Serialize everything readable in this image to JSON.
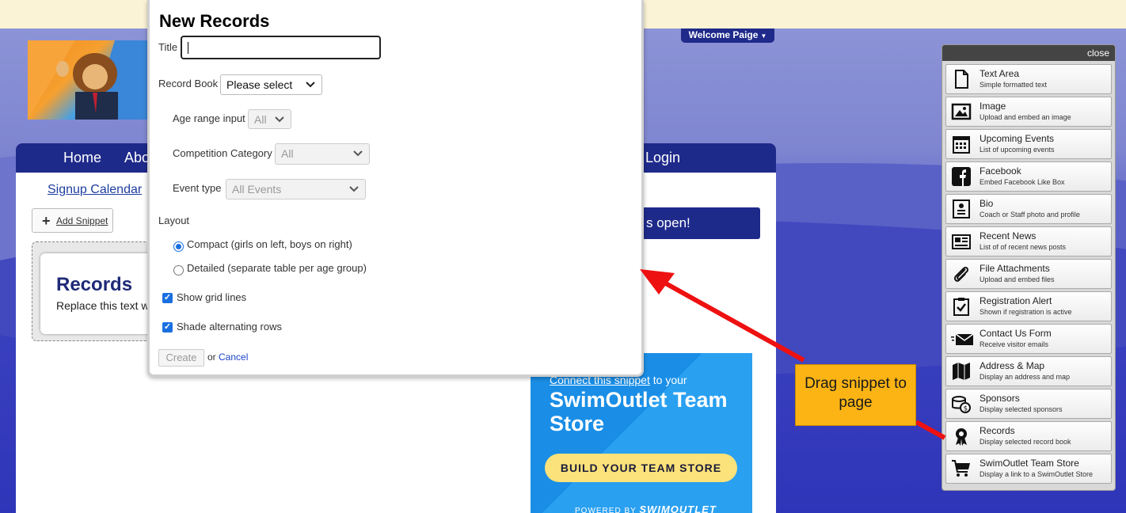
{
  "welcome": {
    "label": "Welcome Paige"
  },
  "nav": {
    "home": "Home",
    "about": "Abo",
    "login": "Login"
  },
  "page": {
    "signup_calendar": "Signup Calendar",
    "add_snippet": "Add Snippet",
    "snippet_title": "Records",
    "snippet_text": "Replace this text w",
    "registration_banner": "s open!"
  },
  "promo": {
    "connect_link": "Connect this snippet",
    "connect_rest": " to your",
    "title": "SwimOutlet Team Store",
    "button": "BUILD YOUR TEAM STORE",
    "powered_by": "POWERED BY",
    "brand": "SWIMOUTLET"
  },
  "modal": {
    "title": "New Records",
    "title_label": "Title",
    "title_value": "",
    "record_book_label": "Record Book",
    "record_book_value": "Please select",
    "age_range_label": "Age range input",
    "age_range_value": "All",
    "competition_label": "Competition Category",
    "competition_value": "All",
    "event_type_label": "Event type",
    "event_type_value": "All Events",
    "layout_label": "Layout",
    "layout_options": [
      {
        "label": "Compact (girls on left, boys on right)",
        "selected": true
      },
      {
        "label": "Detailed (separate table per age group)",
        "selected": false
      }
    ],
    "show_grid_lines": "Show grid lines",
    "shade_rows": "Shade alternating rows",
    "create": "Create",
    "or": "or",
    "cancel": "Cancel"
  },
  "panel": {
    "close": "close",
    "items": [
      {
        "name": "Text Area",
        "desc": "Simple formatted text",
        "icon": "document-icon"
      },
      {
        "name": "Image",
        "desc": "Upload and embed an image",
        "icon": "image-icon"
      },
      {
        "name": "Upcoming Events",
        "desc": "List of upcoming events",
        "icon": "calendar-icon"
      },
      {
        "name": "Facebook",
        "desc": "Embed Facebook Like Box",
        "icon": "facebook-icon"
      },
      {
        "name": "Bio",
        "desc": "Coach or Staff photo and profile",
        "icon": "profile-card-icon"
      },
      {
        "name": "Recent News",
        "desc": "List of of recent news posts",
        "icon": "newspaper-icon"
      },
      {
        "name": "File Attachments",
        "desc": "Upload and embed files",
        "icon": "paperclip-icon"
      },
      {
        "name": "Registration Alert",
        "desc": "Shown if registration is active",
        "icon": "clipboard-check-icon"
      },
      {
        "name": "Contact Us Form",
        "desc": "Receive visitor emails",
        "icon": "envelope-icon"
      },
      {
        "name": "Address & Map",
        "desc": "Display an address and map",
        "icon": "map-icon"
      },
      {
        "name": "Sponsors",
        "desc": "Display selected sponsors",
        "icon": "coins-icon"
      },
      {
        "name": "Records",
        "desc": "Display selected record book",
        "icon": "award-ribbon-icon"
      },
      {
        "name": "SwimOutlet Team Store",
        "desc": "Display a link to a SwimOutlet Store",
        "icon": "cart-icon"
      }
    ]
  },
  "tooltip": {
    "text": "Drag snippet to page"
  },
  "colors": {
    "nav": "#1e2a8a",
    "accent_blue": "#1a6fe0",
    "tooltip": "#fbb414",
    "arrow": "#ee1111",
    "promo_button": "#fbe27a"
  }
}
